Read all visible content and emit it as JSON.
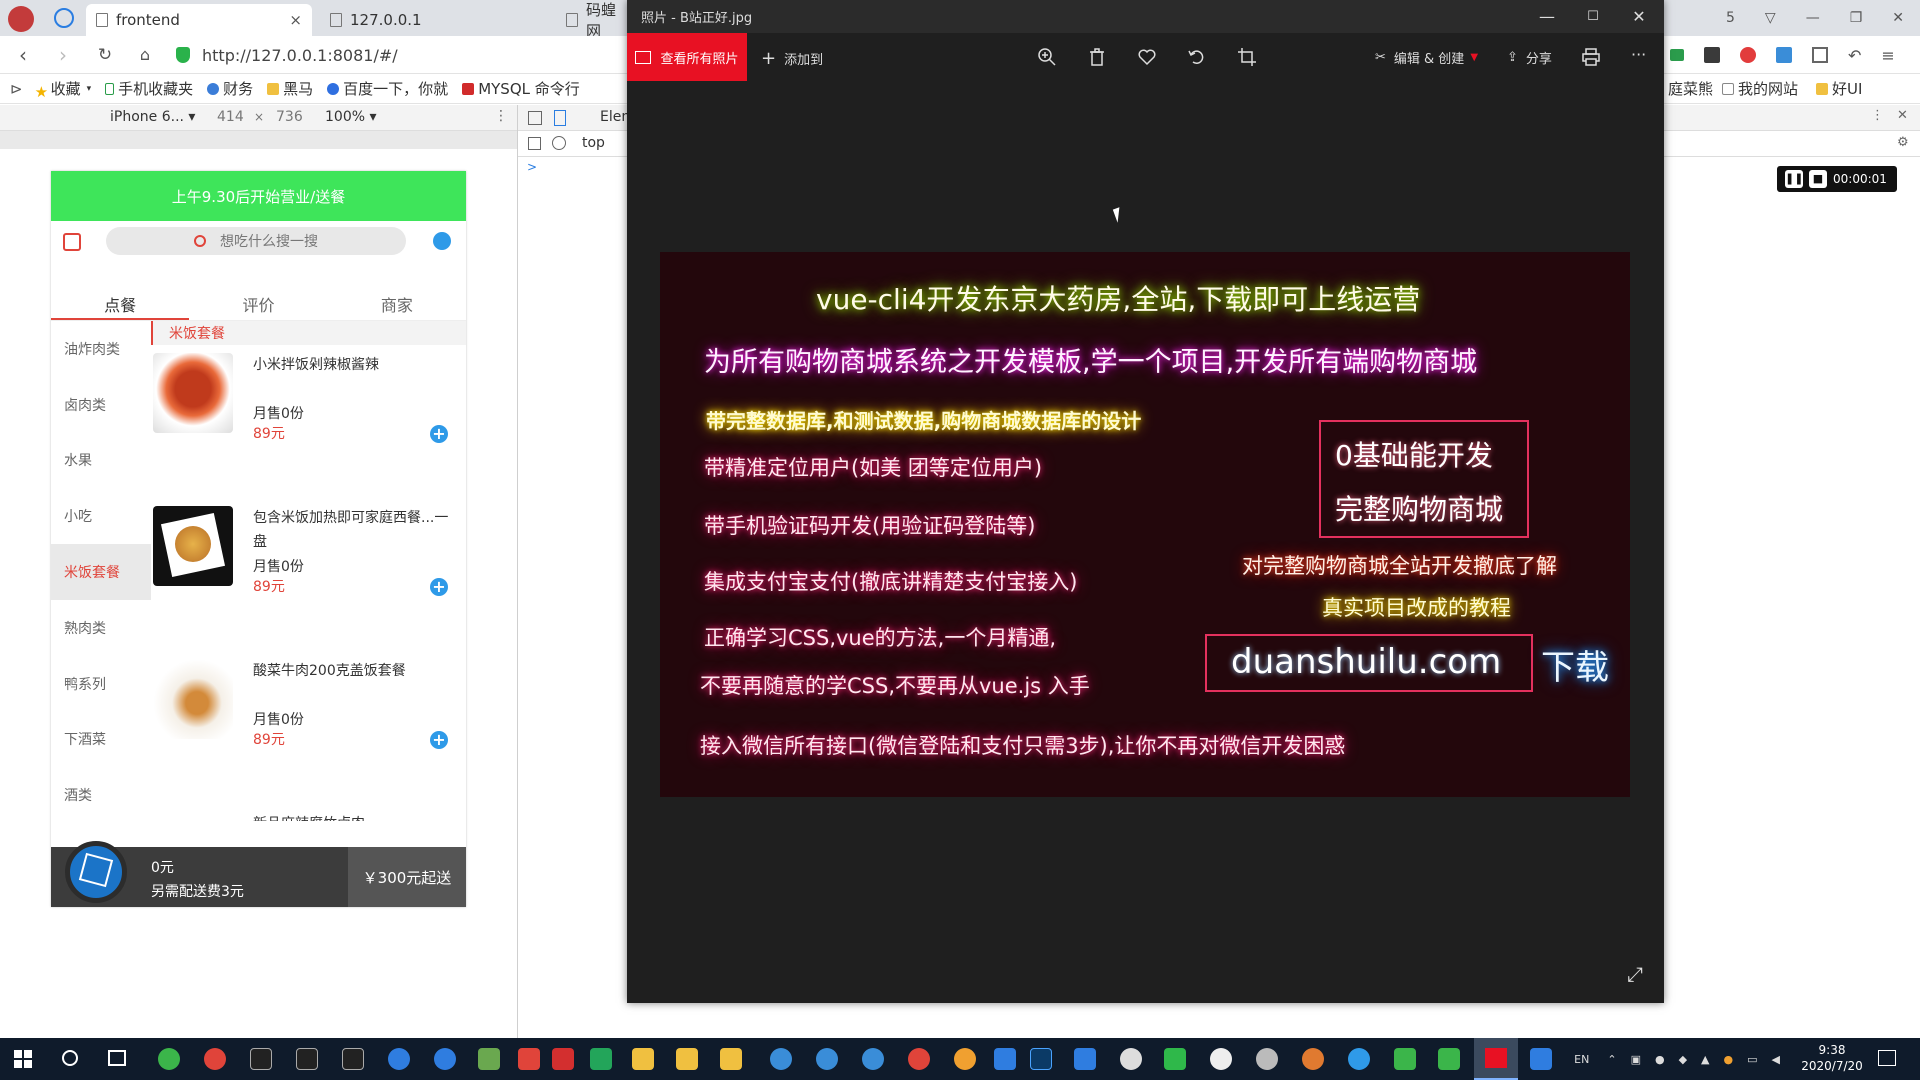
{
  "browser": {
    "tabs": [
      {
        "label": "frontend",
        "close": "×"
      },
      {
        "label": "127.0.0.1"
      },
      {
        "label": "码蝗网"
      }
    ],
    "url": "http://127.0.0.1:8081/#/",
    "bookmarks": [
      "收藏",
      "手机收藏夹",
      "财务",
      "黑马",
      "百度一下，你就",
      "MYSQL 命令行"
    ],
    "bookmarks_right": [
      "庭菜熊",
      "我的网站",
      "好UI"
    ],
    "device": {
      "model": "iPhone 6...",
      "width": "414",
      "x": "×",
      "height": "736",
      "zoom": "100%"
    },
    "elements_label": "Elem",
    "console_context": "top",
    "console_prompt": ">"
  },
  "app": {
    "notice": "上午9.30后开始营业/送餐",
    "search_placeholder": "想吃什么搜一搜",
    "tabs": [
      "点餐",
      "评价",
      "商家"
    ],
    "categories": [
      "油炸肉类",
      "卤肉类",
      "水果",
      "小吃",
      "米饭套餐",
      "熟肉类",
      "鸭系列",
      "下酒菜",
      "酒类"
    ],
    "active_category": "米饭套餐",
    "section_title": "米饭套餐",
    "foods": [
      {
        "name": "小米拌饭剁辣椒酱辣",
        "sales": "月售0份",
        "price": "89元"
      },
      {
        "name": "包含米饭加热即可家庭西餐...一盘",
        "sales": "月售0份",
        "price": "89元"
      },
      {
        "name": "酸菜牛肉200克盖饭套餐",
        "sales": "月售0份",
        "price": "89元"
      },
      {
        "name": "新品麻辣腐竹卤肉",
        "sales": "",
        "price": ""
      }
    ],
    "cart": {
      "total": "0元",
      "delivery_fee": "另需配送费3元",
      "minimum": "￥300元起送"
    }
  },
  "photos": {
    "title": "照片 - B站正好.jpg",
    "view_all": "查看所有照片",
    "add_to": "添加到",
    "edit_create": "编辑 & 创建",
    "share": "分享",
    "more": "···"
  },
  "poster": {
    "line1": "vue-cli4开发东京大药房,全站,下载即可上线运营",
    "line2": "为所有购物商城系统之开发模板,学一个项目,开发所有端购物商城",
    "line3": "带完整数据库,和测试数据,购物商城数据库的设计",
    "line4": "带精准定位用户(如美 团等定位用户)",
    "line5": "带手机验证码开发(用验证码登陆等)",
    "line6": "集成支付宝支付(撤底讲精楚支付宝接入)",
    "line7": "正确学习CSS,vue的方法,一个月精通,",
    "line8": "不要再随意的学CSS,不要再从vue.js 入手",
    "line9": "接入微信所有接口(微信登陆和支付只需3步),让你不再对微信开发困惑",
    "box_line1": "0基础能开发",
    "box_line2": "完整购物商城",
    "pitch1": "对完整购物商城全站开发撤底了解",
    "pitch2": "真实项目改成的教程",
    "site": "duanshuilu.com",
    "download": "下载"
  },
  "recorder": {
    "time": "00:00:01"
  },
  "taskbar": {
    "time": "9:38",
    "date": "2020/7/20",
    "lang": "EN"
  },
  "colors": {
    "notice_green": "#3ee55a",
    "accent_red": "#e0443a",
    "photos_red": "#e81123",
    "plus_blue": "#2e9ae8"
  }
}
